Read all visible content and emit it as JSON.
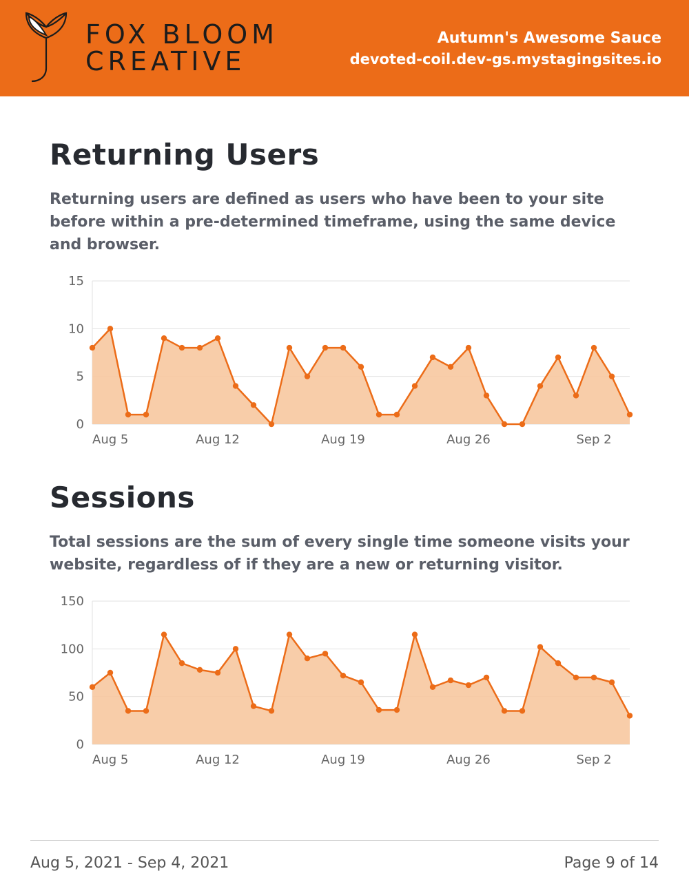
{
  "header": {
    "brand_line1": "FOX  BLOOM",
    "brand_line2": "CREATIVE",
    "client": "Autumn's Awesome Sauce",
    "domain": "devoted-coil.dev-gs.mystagingsites.io"
  },
  "sections": {
    "returning": {
      "title": "Returning Users",
      "desc": "Returning users are defined as users who have been to your site before within a pre-determined timeframe, using the same device and browser."
    },
    "sessions": {
      "title": "Sessions",
      "desc": "Total sessions are the sum of every single time someone visits your website, regardless of if they are a new or returning visitor."
    }
  },
  "footer": {
    "date_range": "Aug 5, 2021 - Sep 4, 2021",
    "page": "Page 9 of 14"
  },
  "chart_data": [
    {
      "id": "returning-users-chart",
      "title": "Returning Users",
      "type": "area",
      "xlabel": "",
      "ylabel": "",
      "ylim": [
        0,
        15
      ],
      "yticks": [
        0,
        5,
        10,
        15
      ],
      "x_categories": [
        "Aug 5",
        "Aug 6",
        "Aug 7",
        "Aug 8",
        "Aug 9",
        "Aug 10",
        "Aug 11",
        "Aug 12",
        "Aug 13",
        "Aug 14",
        "Aug 15",
        "Aug 16",
        "Aug 17",
        "Aug 18",
        "Aug 19",
        "Aug 20",
        "Aug 21",
        "Aug 22",
        "Aug 23",
        "Aug 24",
        "Aug 25",
        "Aug 26",
        "Aug 27",
        "Aug 28",
        "Aug 29",
        "Aug 30",
        "Aug 31",
        "Sep 1",
        "Sep 2",
        "Sep 3",
        "Sep 4"
      ],
      "x_tick_labels": [
        "Aug 5",
        "Aug 12",
        "Aug 19",
        "Aug 26",
        "Sep 2"
      ],
      "x_tick_indices": [
        0,
        7,
        14,
        21,
        28
      ],
      "values": [
        8,
        10,
        1,
        1,
        9,
        8,
        8,
        9,
        4,
        2,
        0,
        8,
        5,
        8,
        8,
        6,
        1,
        1,
        4,
        7,
        6,
        8,
        3,
        0,
        0,
        4,
        7,
        3,
        8,
        5,
        1
      ]
    },
    {
      "id": "sessions-chart",
      "title": "Sessions",
      "type": "area",
      "xlabel": "",
      "ylabel": "",
      "ylim": [
        0,
        150
      ],
      "yticks": [
        0,
        50,
        100,
        150
      ],
      "x_categories": [
        "Aug 5",
        "Aug 6",
        "Aug 7",
        "Aug 8",
        "Aug 9",
        "Aug 10",
        "Aug 11",
        "Aug 12",
        "Aug 13",
        "Aug 14",
        "Aug 15",
        "Aug 16",
        "Aug 17",
        "Aug 18",
        "Aug 19",
        "Aug 20",
        "Aug 21",
        "Aug 22",
        "Aug 23",
        "Aug 24",
        "Aug 25",
        "Aug 26",
        "Aug 27",
        "Aug 28",
        "Aug 29",
        "Aug 30",
        "Aug 31",
        "Sep 1",
        "Sep 2",
        "Sep 3",
        "Sep 4"
      ],
      "x_tick_labels": [
        "Aug 5",
        "Aug 12",
        "Aug 19",
        "Aug 26",
        "Sep 2"
      ],
      "x_tick_indices": [
        0,
        7,
        14,
        21,
        28
      ],
      "values": [
        60,
        75,
        35,
        35,
        115,
        85,
        78,
        75,
        100,
        40,
        35,
        115,
        90,
        95,
        72,
        65,
        36,
        36,
        115,
        60,
        67,
        62,
        70,
        35,
        35,
        102,
        85,
        70,
        70,
        65,
        30
      ]
    }
  ]
}
